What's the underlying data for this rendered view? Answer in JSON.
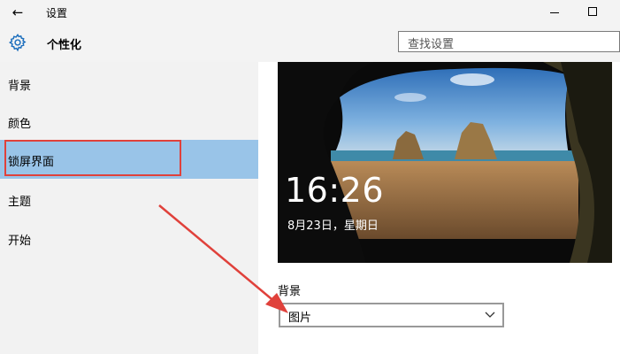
{
  "window": {
    "title": "设置"
  },
  "header": {
    "title": "个性化",
    "search_placeholder": "查找设置"
  },
  "sidebar": {
    "items": [
      {
        "label": "背景"
      },
      {
        "label": "颜色"
      },
      {
        "label": "锁屏界面",
        "selected": true
      },
      {
        "label": "主题"
      },
      {
        "label": "开始"
      }
    ]
  },
  "lockscreen": {
    "time": "16:26",
    "date": "8月23日，星期日"
  },
  "background": {
    "label": "背景",
    "selected": "图片"
  },
  "colors": {
    "accent_selected": "#99c4e8",
    "highlight_box": "#e0413b",
    "gear": "#1c6ebd"
  }
}
